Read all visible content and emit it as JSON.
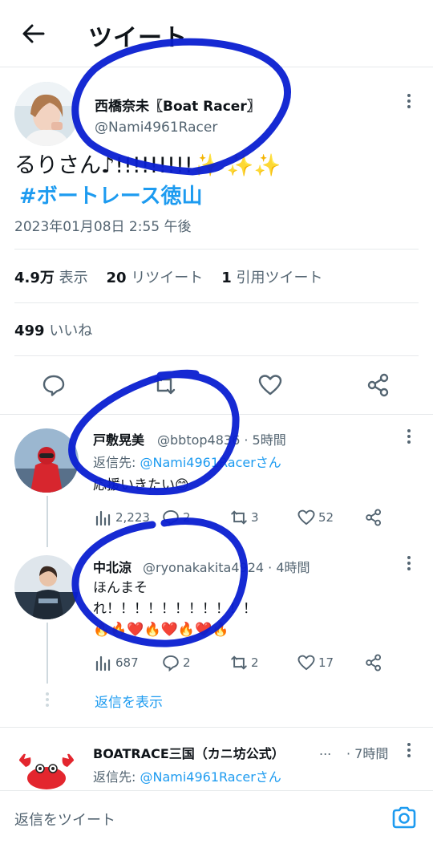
{
  "header": {
    "title": "ツイート"
  },
  "main_tweet": {
    "display_name": "西橋奈未〖Boat Racer〗",
    "handle": "@Nami4961Racer",
    "text": "るりさん♪!!!!!!!!!✨ ✨✨",
    "hashtag": "#ボートレース徳山",
    "timestamp": "2023年01月08日 2:55 午後",
    "views_count": "4.9万",
    "views_label": "表示",
    "retweets_count": "20",
    "retweets_label": "リツイート",
    "quotes_count": "1",
    "quotes_label": "引用ツイート",
    "likes_count": "499",
    "likes_label": "いいね"
  },
  "replies": [
    {
      "display_name": "戸敷晃美",
      "handle_meta": "@bbtop4836 · 5時間",
      "reply_to_prefix": "返信先: ",
      "reply_to_handle": "@Nami4961Racerさん",
      "text": "応援いきたい😊",
      "views": "2,223",
      "replies": "2",
      "retweets": "3",
      "likes": "52"
    },
    {
      "display_name": "中北涼",
      "handle_meta": "@ryonakakita4924 · 4時間",
      "text_line1": "ほんまそ",
      "text_line2": "れ！！！！！！！！！！！",
      "text_line3": "🔥🔥❤️🔥❤️🔥❤️🔥",
      "views": "687",
      "replies": "2",
      "retweets": "2",
      "likes": "17",
      "show_replies": "返信を表示"
    },
    {
      "display_name": "BOATRACE三国（カニ坊公式）",
      "ellipsis": "...",
      "meta": "· 7時間",
      "reply_to_prefix": "返信先: ",
      "reply_to_handle": "@Nami4961Racerさん"
    }
  ],
  "reply_bar": {
    "placeholder": "返信をツイート"
  },
  "colors": {
    "accent": "#1d9bf0",
    "ink": "#0f1419",
    "muted": "#536471",
    "marker": "#0a1fd1"
  },
  "icons": [
    "back-arrow-icon",
    "more-icon",
    "reply-icon",
    "retweet-icon",
    "like-icon",
    "share-icon",
    "views-icon",
    "camera-icon"
  ]
}
